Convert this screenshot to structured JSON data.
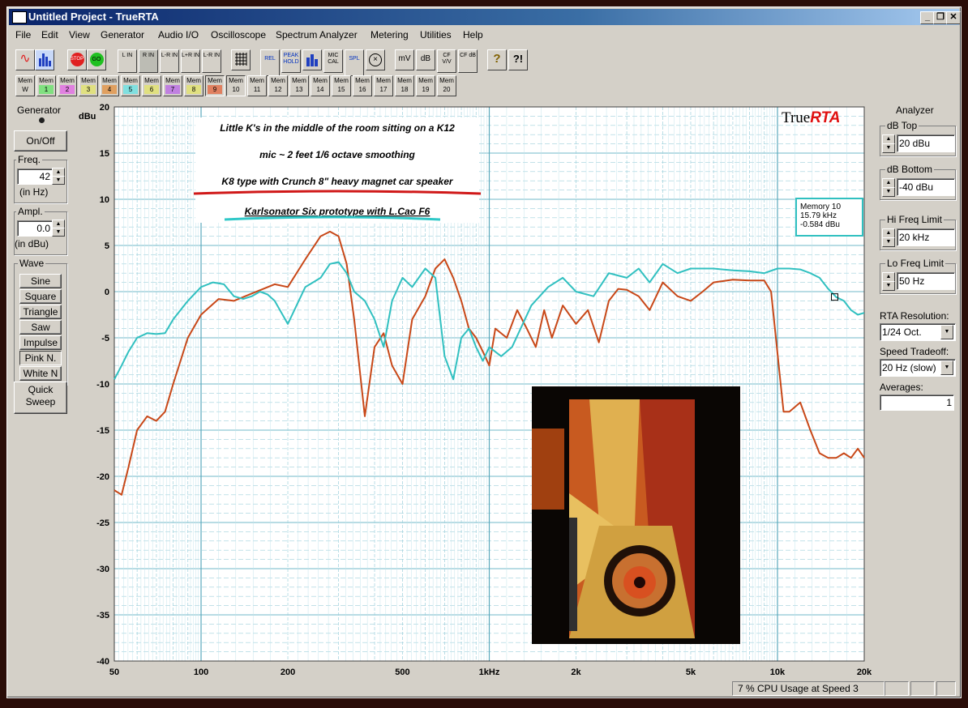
{
  "window": {
    "title": "Untitled Project - TrueRTA",
    "minimize": "_",
    "maximize": "❐",
    "close": "✕"
  },
  "menu": [
    "File",
    "Edit",
    "View",
    "Generator",
    "Audio I/O",
    "Oscilloscope",
    "Spectrum Analyzer",
    "Metering",
    "Utilities",
    "Help"
  ],
  "toolbar1": {
    "gen_icon": "sine-wave-icon",
    "rta_icon": "spectrum-bars-icon",
    "stop": "STOP",
    "go": "GO",
    "channels": [
      "L IN",
      "R IN",
      "L-R IN",
      "L+R IN",
      "L-R IN"
    ],
    "grid_icon": "grid-icon",
    "rel": "REL",
    "peak_hold": "PEAK HOLD",
    "mic_cal": "MIC CAL",
    "spl": "SPL",
    "mv": "mV",
    "db": "dB",
    "cf_vv": "CF V/V",
    "cf_db": "CF dB",
    "help_icons": [
      "?",
      "?!"
    ]
  },
  "memory_toolbar": {
    "label": "Mem",
    "items": [
      "W",
      "1",
      "2",
      "3",
      "4",
      "5",
      "6",
      "7",
      "8",
      "9",
      "10",
      "11",
      "12",
      "13",
      "14",
      "15",
      "16",
      "17",
      "18",
      "19",
      "20"
    ],
    "colors": [
      "#d4d0c8",
      "#80e080",
      "#e080e0",
      "#e0e080",
      "#e0a060",
      "#80e0e0",
      "#e0e080",
      "#c080e0",
      "#e0e080",
      "#e08060",
      "#d4d0c8",
      "#d4d0c8",
      "#d4d0c8",
      "#d4d0c8",
      "#d4d0c8",
      "#d4d0c8",
      "#d4d0c8",
      "#d4d0c8",
      "#d4d0c8",
      "#d4d0c8",
      "#d4d0c8"
    ]
  },
  "generator": {
    "title": "Generator",
    "onoff": "On/Off",
    "freq_label": "Freq.",
    "freq_value": "42",
    "freq_unit": "(in Hz)",
    "ampl_label": "Ampl.",
    "ampl_value": "0.0",
    "ampl_unit": "(in dBu)",
    "wave_label": "Wave",
    "waves": [
      "Sine",
      "Square",
      "Triangle",
      "Saw",
      "Impulse",
      "Pink N.",
      "White N"
    ],
    "quick_sweep": "Quick Sweep"
  },
  "analyzer": {
    "title": "Analyzer",
    "db_top_label": "dB Top",
    "db_top": "20 dBu",
    "db_bottom_label": "dB Bottom",
    "db_bottom": "-40 dBu",
    "hi_freq_label": "Hi Freq Limit",
    "hi_freq": "20 kHz",
    "lo_freq_label": "Lo Freq Limit",
    "lo_freq": "50 Hz",
    "rta_res_label": "RTA Resolution:",
    "rta_res": "1/24 Oct.",
    "speed_label": "Speed Tradeoff:",
    "speed": "20 Hz (slow)",
    "averages_label": "Averages:",
    "averages": "1"
  },
  "status": {
    "cpu": "7 % CPU Usage at Speed 3"
  },
  "colors": {
    "plot_bg": "#ffffff",
    "grid": "#80c8d8",
    "red_series": "#c84818",
    "cyan_series": "#30c0c0",
    "brand_red": "#e01010"
  },
  "chart_data": {
    "type": "line",
    "brand": [
      "True",
      "RTA"
    ],
    "ylabel": "dBu",
    "ylim": [
      -40,
      20
    ],
    "xlim": [
      50,
      20000
    ],
    "xscale": "log",
    "yticks": [
      20,
      15,
      10,
      5,
      0,
      -5,
      -10,
      -15,
      -20,
      -25,
      -30,
      -35,
      -40
    ],
    "xticks": [
      {
        "v": 50,
        "l": "50"
      },
      {
        "v": 100,
        "l": "100"
      },
      {
        "v": 200,
        "l": "200"
      },
      {
        "v": 500,
        "l": "500"
      },
      {
        "v": 1000,
        "l": "1kHz"
      },
      {
        "v": 2000,
        "l": "2k"
      },
      {
        "v": 5000,
        "l": "5k"
      },
      {
        "v": 10000,
        "l": "10k"
      },
      {
        "v": 20000,
        "l": "20k"
      }
    ],
    "annotations": [
      "Little K's in the middle of the room sitting on a K12",
      "mic ~ 2 feet   1/6 octave smoothing",
      "K8 type with Crunch  8\"  heavy magnet car speaker",
      "Karlsonator Six prototype with L.Cao F6"
    ],
    "marker": {
      "lines": [
        "Memory 10",
        "15.79 kHz",
        "-0.584 dBu"
      ],
      "x": 15790,
      "y": -0.584
    },
    "series": [
      {
        "name": "K8 type with Crunch  8\"  heavy magnet car speaker",
        "color": "#c84818",
        "x": [
          50,
          53,
          56,
          60,
          65,
          70,
          75,
          80,
          90,
          100,
          115,
          130,
          150,
          180,
          200,
          230,
          260,
          280,
          300,
          320,
          340,
          370,
          400,
          430,
          460,
          500,
          540,
          600,
          650,
          700,
          750,
          800,
          850,
          900,
          950,
          1000,
          1050,
          1150,
          1250,
          1350,
          1450,
          1550,
          1650,
          1800,
          2000,
          2200,
          2400,
          2600,
          2800,
          3000,
          3300,
          3600,
          4000,
          4500,
          5000,
          5500,
          6000,
          7000,
          8000,
          9000,
          9500,
          10500,
          11000,
          12000,
          13000,
          14000,
          15000,
          16000,
          17000,
          18000,
          19000,
          20000
        ],
        "y": [
          -21.5,
          -22,
          -19,
          -15,
          -13.5,
          -14,
          -13,
          -10,
          -5,
          -2.5,
          -0.8,
          -1,
          -0.2,
          0.8,
          0.5,
          3.5,
          6,
          6.5,
          6,
          3,
          -3,
          -13.5,
          -6,
          -4.5,
          -8,
          -10,
          -3,
          -0.5,
          2.5,
          3.5,
          1.5,
          -1,
          -4,
          -5,
          -6.5,
          -8,
          -4,
          -5,
          -2,
          -4,
          -6,
          -2,
          -5,
          -1.5,
          -3.5,
          -2,
          -5.5,
          -1,
          0.3,
          0.2,
          -0.5,
          -2,
          1,
          -0.5,
          -1,
          0,
          1,
          1.3,
          1.2,
          1.2,
          0,
          -13,
          -13,
          -12,
          -15,
          -17.5,
          -18,
          -18,
          -17.5,
          -18,
          -17,
          -18
        ]
      },
      {
        "name": "Karlsonator Six prototype with L.Cao F6",
        "color": "#30c0c0",
        "x": [
          50,
          53,
          56,
          60,
          65,
          70,
          75,
          80,
          90,
          100,
          110,
          120,
          130,
          140,
          150,
          160,
          170,
          180,
          200,
          230,
          260,
          280,
          300,
          320,
          340,
          370,
          400,
          430,
          460,
          500,
          540,
          600,
          650,
          700,
          750,
          800,
          850,
          900,
          950,
          1000,
          1100,
          1200,
          1400,
          1600,
          1800,
          2000,
          2300,
          2600,
          3000,
          3300,
          3600,
          4000,
          4500,
          5000,
          6000,
          7000,
          8000,
          9000,
          10000,
          11000,
          12000,
          13000,
          14000,
          15000,
          16000,
          17000,
          18000,
          19000,
          20000
        ],
        "y": [
          -9.5,
          -8,
          -6.5,
          -5,
          -4.5,
          -4.6,
          -4.5,
          -3,
          -1,
          0.5,
          1,
          0.8,
          -0.5,
          -0.8,
          -0.5,
          0,
          -0.3,
          -1,
          -3.5,
          0.5,
          1.5,
          3,
          3.2,
          2,
          0,
          -1,
          -3,
          -6,
          -1,
          1.5,
          0.5,
          2.5,
          1.5,
          -7,
          -9.5,
          -5,
          -4,
          -6,
          -7.5,
          -6,
          -7,
          -6,
          -1.5,
          0.5,
          1.5,
          0,
          -0.5,
          2,
          1.5,
          2.5,
          1,
          3,
          2,
          2.5,
          2.5,
          2.3,
          2.2,
          2,
          2.5,
          2.5,
          2.4,
          2,
          1.5,
          0.3,
          -0.6,
          -1,
          -2,
          -2.5,
          -2.3
        ]
      }
    ]
  }
}
